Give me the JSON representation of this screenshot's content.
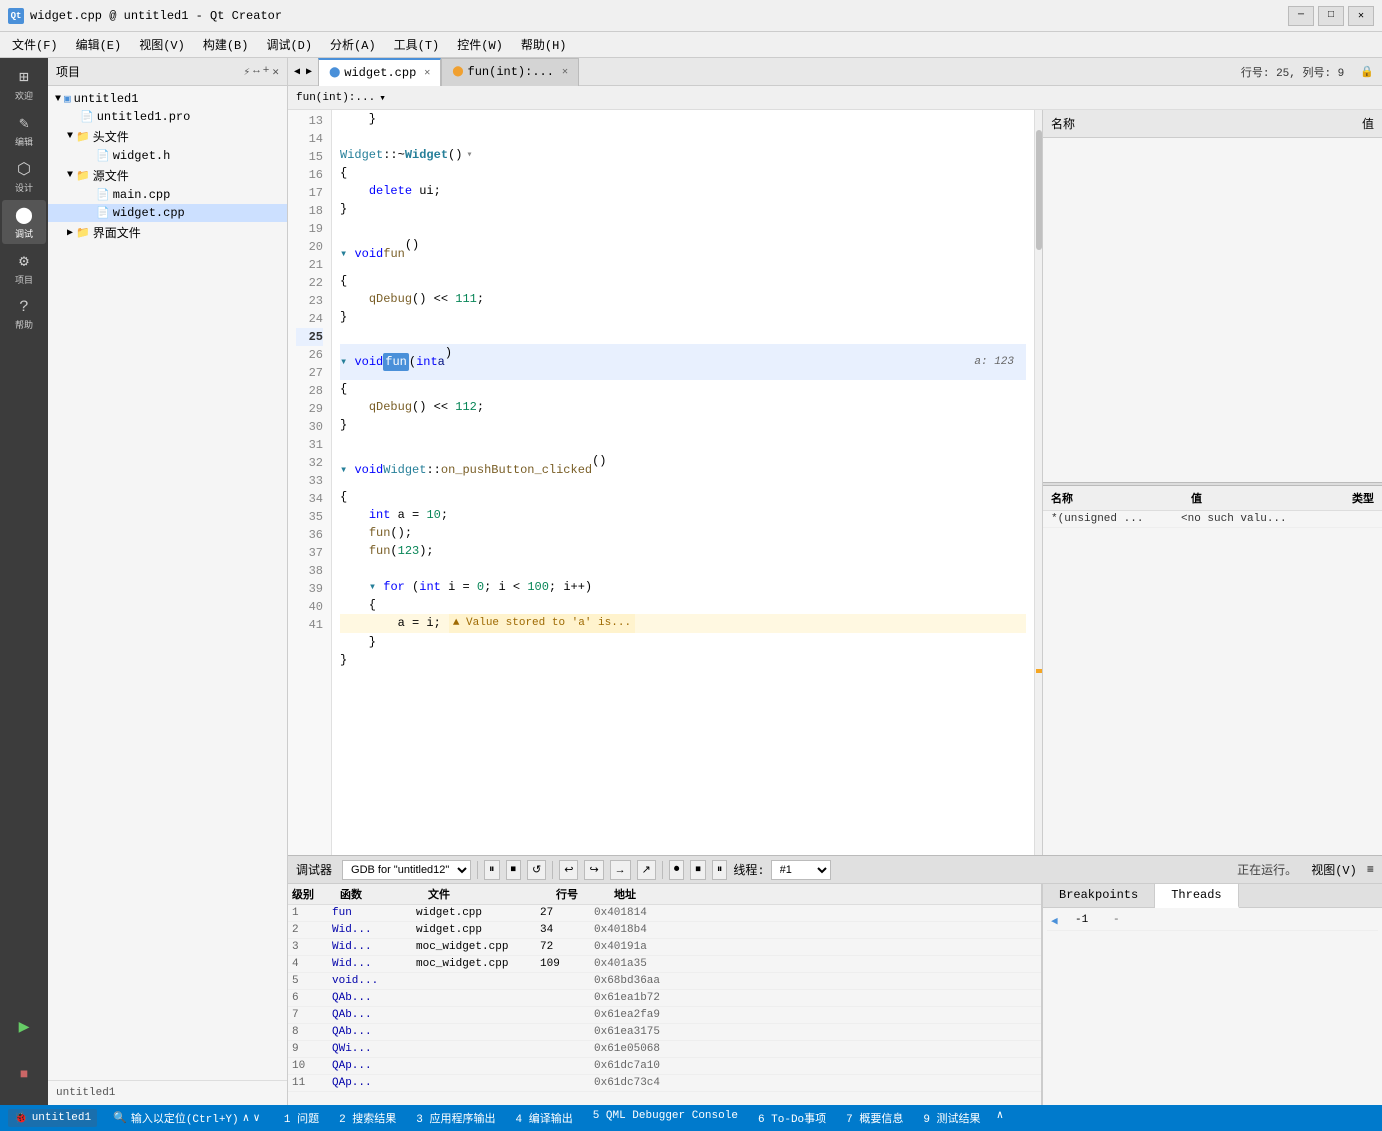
{
  "titleBar": {
    "icon": "Qt",
    "title": "widget.cpp @ untitled1 - Qt Creator",
    "minBtn": "─",
    "maxBtn": "□",
    "closeBtn": "✕"
  },
  "menuBar": {
    "items": [
      "文件(F)",
      "编辑(E)",
      "视图(V)",
      "构建(B)",
      "调试(D)",
      "分析(A)",
      "工具(T)",
      "控件(W)",
      "帮助(H)"
    ]
  },
  "sidebar": {
    "icons": [
      {
        "name": "welcome-icon",
        "symbol": "⊞",
        "label": "欢迎"
      },
      {
        "name": "edit-icon",
        "symbol": "✎",
        "label": "编辑"
      },
      {
        "name": "design-icon",
        "symbol": "⬡",
        "label": "设计"
      },
      {
        "name": "debug-icon",
        "symbol": "⬤",
        "label": "调试",
        "active": true
      },
      {
        "name": "project-icon",
        "symbol": "⚙",
        "label": "项目"
      },
      {
        "name": "help-icon",
        "symbol": "?",
        "label": "帮助"
      }
    ],
    "bottomIcons": [
      {
        "name": "build-icon",
        "symbol": "▶"
      },
      {
        "name": "step-icon",
        "symbol": "⏭"
      }
    ]
  },
  "projectPanel": {
    "title": "项目",
    "tree": [
      {
        "id": "untitled1",
        "label": "untitled1",
        "indent": 0,
        "type": "project",
        "expanded": true
      },
      {
        "id": "untitled1pro",
        "label": "untitled1.pro",
        "indent": 1,
        "type": "pro"
      },
      {
        "id": "headers",
        "label": "头文件",
        "indent": 1,
        "type": "folder",
        "expanded": true
      },
      {
        "id": "widget-h",
        "label": "widget.h",
        "indent": 2,
        "type": "h"
      },
      {
        "id": "sources",
        "label": "源文件",
        "indent": 1,
        "type": "folder",
        "expanded": true
      },
      {
        "id": "main-cpp",
        "label": "main.cpp",
        "indent": 2,
        "type": "cpp"
      },
      {
        "id": "widget-cpp",
        "label": "widget.cpp",
        "indent": 2,
        "type": "cpp",
        "selected": true
      },
      {
        "id": "forms",
        "label": "界面文件",
        "indent": 1,
        "type": "folder",
        "expanded": false
      }
    ]
  },
  "editorTabs": {
    "items": [
      {
        "id": "widget-cpp-tab",
        "label": "widget.cpp",
        "active": true,
        "modified": false
      },
      {
        "id": "fun-tab",
        "label": "fun(int):...",
        "active": false
      }
    ],
    "lineInfo": "行号: 25, 列号: 9"
  },
  "breadcrumb": {
    "items": [
      "fun(int):..."
    ]
  },
  "codeLines": [
    {
      "num": 13,
      "content": "    }",
      "type": "normal"
    },
    {
      "num": 14,
      "content": "",
      "type": "normal"
    },
    {
      "num": 15,
      "content": "Widget::~Widget()",
      "type": "normal",
      "hasFold": true,
      "class": "normal"
    },
    {
      "num": 16,
      "content": "{",
      "type": "normal"
    },
    {
      "num": 17,
      "content": "    delete ui;",
      "type": "normal"
    },
    {
      "num": 18,
      "content": "}",
      "type": "normal"
    },
    {
      "num": 19,
      "content": "",
      "type": "normal"
    },
    {
      "num": 20,
      "content": "void fun()",
      "type": "normal",
      "hasFold": true
    },
    {
      "num": 21,
      "content": "{",
      "type": "normal"
    },
    {
      "num": 22,
      "content": "    qDebug() << 111;",
      "type": "normal"
    },
    {
      "num": 23,
      "content": "}",
      "type": "normal"
    },
    {
      "num": 24,
      "content": "",
      "type": "normal"
    },
    {
      "num": 25,
      "content": "void fun(int a)",
      "type": "highlighted",
      "hasFold": true,
      "valueHint": "a: 123"
    },
    {
      "num": 26,
      "content": "{",
      "type": "normal"
    },
    {
      "num": 27,
      "content": "    qDebug() << 112;",
      "type": "normal"
    },
    {
      "num": 28,
      "content": "}",
      "type": "normal"
    },
    {
      "num": 29,
      "content": "",
      "type": "normal"
    },
    {
      "num": 30,
      "content": "void Widget::on_pushButton_clicked()",
      "type": "normal",
      "hasFold": true
    },
    {
      "num": 31,
      "content": "{",
      "type": "normal"
    },
    {
      "num": 32,
      "content": "    int a = 10;",
      "type": "normal"
    },
    {
      "num": 33,
      "content": "    fun();",
      "type": "normal"
    },
    {
      "num": 34,
      "content": "    fun(123);",
      "type": "normal"
    },
    {
      "num": 35,
      "content": "",
      "type": "normal"
    },
    {
      "num": 36,
      "content": "    for (int i = 0; i < 100; i++)",
      "type": "normal",
      "hasFold": true
    },
    {
      "num": 37,
      "content": "    {",
      "type": "normal"
    },
    {
      "num": 38,
      "content": "        a = i;",
      "type": "warning",
      "warning": "▲ Value stored to 'a' is..."
    },
    {
      "num": 39,
      "content": "    }",
      "type": "normal"
    },
    {
      "num": 40,
      "content": "}",
      "type": "normal"
    },
    {
      "num": 41,
      "content": "",
      "type": "normal"
    }
  ],
  "rightPanel": {
    "watchHeader": {
      "name": "名称",
      "value": "值"
    },
    "localsHeader": {
      "name": "名称",
      "value": "值",
      "type": "类型"
    },
    "localsRows": [
      {
        "name": "*(unsigned ...",
        "value": "<no such valu...",
        "type": ""
      }
    ]
  },
  "debugToolbar": {
    "label": "调试器",
    "gdbLabel": "GDB for \"untitled12\"",
    "buttons": [
      "▌▌",
      "⏹",
      "↺",
      "↩",
      "↪",
      "→",
      "↗",
      "↘",
      "⏺",
      "⏹",
      "⏸",
      "线程:",
      "#1"
    ],
    "runningLabel": "正在运行。",
    "viewLabel": "视图(V)",
    "moreBtn": "≡"
  },
  "stackPanel": {
    "headers": [
      "级别",
      "函数",
      "文件",
      "行号",
      "地址"
    ],
    "rows": [
      {
        "level": "1",
        "func": "fun",
        "file": "widget.cpp",
        "line": "27",
        "addr": "0x401814"
      },
      {
        "level": "2",
        "func": "Wid...",
        "file": "widget.cpp",
        "line": "34",
        "addr": "0x4018b4"
      },
      {
        "level": "3",
        "func": "Wid...",
        "file": "moc_widget.cpp",
        "line": "72",
        "addr": "0x40191a"
      },
      {
        "level": "4",
        "func": "Wid...",
        "file": "moc_widget.cpp",
        "line": "109",
        "addr": "0x401a35"
      },
      {
        "level": "5",
        "func": "void...",
        "file": "",
        "line": "",
        "addr": "0x68bd36aa"
      },
      {
        "level": "6",
        "func": "QAb...",
        "file": "",
        "line": "",
        "addr": "0x61ea1b72"
      },
      {
        "level": "7",
        "func": "QAb...",
        "file": "",
        "line": "",
        "addr": "0x61ea2fa9"
      },
      {
        "level": "8",
        "func": "QAb...",
        "file": "",
        "line": "",
        "addr": "0x61ea3175"
      },
      {
        "level": "9",
        "func": "QWi...",
        "file": "",
        "line": "",
        "addr": "0x61e05068"
      },
      {
        "level": "10",
        "func": "QAp...",
        "file": "",
        "line": "",
        "addr": "0x61dc7a10"
      },
      {
        "level": "11",
        "func": "QAp...",
        "file": "",
        "line": "",
        "addr": "0x61dc73c4"
      }
    ]
  },
  "threadsPanel": {
    "tabs": [
      "Breakpoints",
      "Threads"
    ],
    "activeTab": "Threads",
    "rows": [
      {
        "arrow": "◀",
        "num": "-1",
        "func": "-"
      }
    ]
  },
  "statusBar": {
    "items": [
      "1 问题",
      "2 搜索结果",
      "3 应用程序输出",
      "4 编译输出",
      "5 QML Debugger Console",
      "6 To-Do事项",
      "7 概要信息",
      "9 测试结果"
    ],
    "search": "输入以定位(Ctrl+Y)",
    "upDown": "∧∨"
  },
  "colors": {
    "accent": "#4a90d9",
    "keyword": "#0000ff",
    "function": "#795e26",
    "string": "#a31515",
    "number": "#098658",
    "comment": "#6a9955",
    "warning": "#f5a623",
    "titleBg": "#f0f0f0",
    "activeDebug": "#007acc"
  }
}
